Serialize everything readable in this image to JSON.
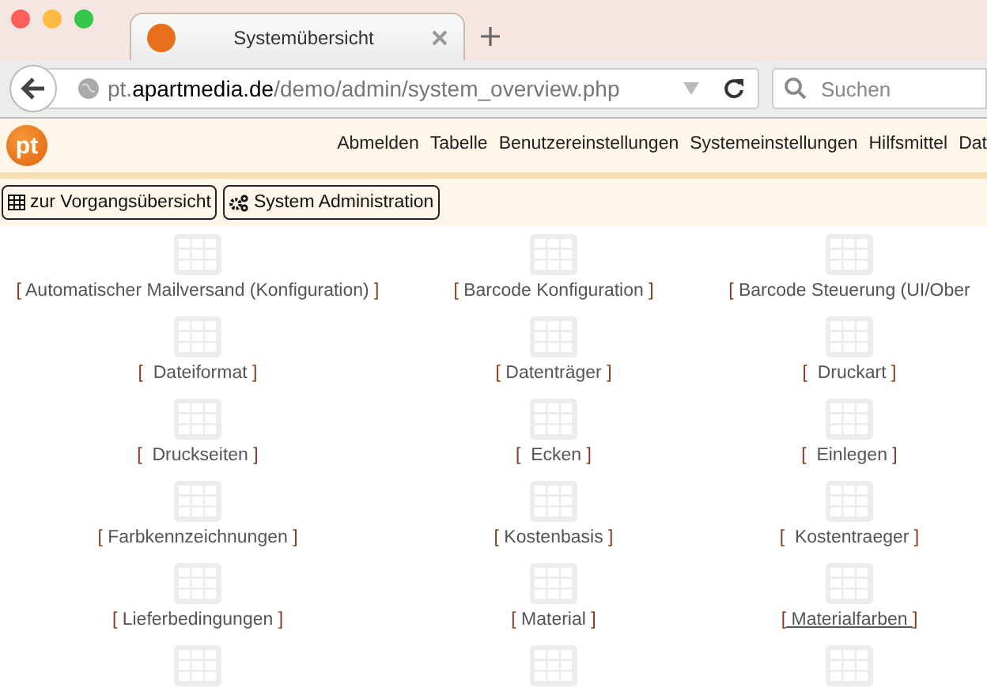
{
  "browser": {
    "tab": {
      "title": "Systemübersicht",
      "selected": true
    },
    "address": {
      "subdomain": "pt.",
      "host": "apartmedia.de",
      "path": "/demo/admin/system_overview.php"
    },
    "search": {
      "placeholder": "Suchen"
    }
  },
  "app": {
    "logo": "pt",
    "menu": [
      "Abmelden",
      "Tabelle",
      "Benutzereinstellungen",
      "Systemeinstellungen",
      "Hilfsmittel",
      "Dat"
    ],
    "toolbar": [
      {
        "label": "zur Vorgangsübersicht",
        "kind": "table"
      },
      {
        "label": "System Administration",
        "kind": "gears"
      }
    ]
  },
  "items": [
    {
      "label": "[ Automatischer Mailversand (Konfiguration) ]",
      "hovered": false
    },
    {
      "label": "[ Barcode Konfiguration ]",
      "hovered": false
    },
    {
      "label": "[ Barcode Steuerung (UI/Ober",
      "hovered": false
    },
    {
      "label": "[  Dateiformat ]",
      "hovered": false
    },
    {
      "label": "[ Datenträger ]",
      "hovered": false
    },
    {
      "label": "[  Druckart ]",
      "hovered": false
    },
    {
      "label": "[  Druckseiten ]",
      "hovered": false
    },
    {
      "label": "[  Ecken ]",
      "hovered": false
    },
    {
      "label": "[  Einlegen ]",
      "hovered": false
    },
    {
      "label": "[ Farbkennzeichnungen ]",
      "hovered": false
    },
    {
      "label": "[ Kostenbasis ]",
      "hovered": false
    },
    {
      "label": "[  Kostentraeger ]",
      "hovered": false
    },
    {
      "label": "[ Lieferbedingungen ]",
      "hovered": false
    },
    {
      "label": "[ Material ]",
      "hovered": false
    },
    {
      "label": "[ Materialfarben ]",
      "hovered": true
    }
  ]
}
